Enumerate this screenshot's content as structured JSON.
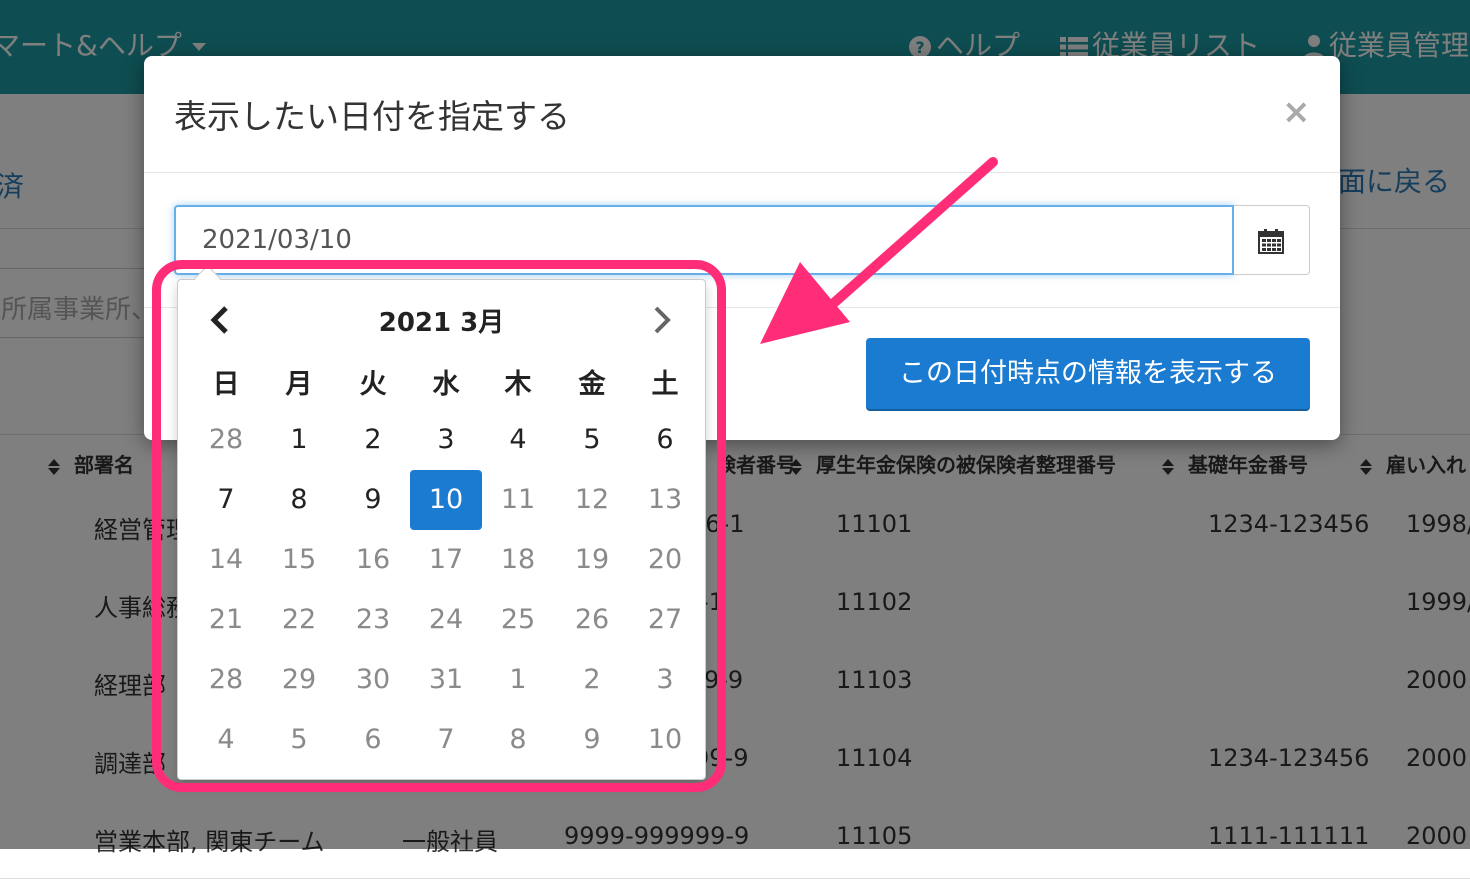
{
  "navbar": {
    "left_label": "マート&ヘルプ",
    "help_label": "ヘルプ",
    "list_label": "従業員リスト",
    "manage_label": "従業員管理"
  },
  "background": {
    "left_link": "済",
    "right_link": "面に戻る",
    "search_placeholder": "所属事業所、",
    "table": {
      "headers": [
        "部署名",
        "険者番号",
        "厚生年金保険の被保険者整理番号",
        "基礎年金番号",
        "雇い入れ"
      ],
      "rows": [
        [
          "経営管理",
          "",
          "56-1",
          "11101",
          "1234-123456",
          "1998/"
        ],
        [
          "人事総務",
          "",
          "-1",
          "11102",
          "",
          "1999/"
        ],
        [
          "経理部",
          "",
          "9-9",
          "11103",
          "",
          "2000"
        ],
        [
          "調達部",
          "",
          "99-9",
          "11104",
          "1234-123456",
          "2000"
        ],
        [
          "営業本部, 関東チーム",
          "一般社員",
          "9999-999999-9",
          "11105",
          "1111-111111",
          "2000"
        ]
      ]
    }
  },
  "modal": {
    "title": "表示したい日付を指定する",
    "close": "×",
    "date_value": "2021/03/10",
    "calendar_icon": "calendar-icon",
    "submit_label": "この日付時点の情報を表示する"
  },
  "datepicker": {
    "month_label": "2021 3月",
    "prev_icon": "chevron-left-icon",
    "next_icon": "chevron-right-icon",
    "weekdays": [
      "日",
      "月",
      "火",
      "水",
      "木",
      "金",
      "土"
    ],
    "selected": "10",
    "weeks": [
      [
        [
          "28",
          "muted"
        ],
        [
          "1",
          "in"
        ],
        [
          "2",
          "in"
        ],
        [
          "3",
          "in"
        ],
        [
          "4",
          "in"
        ],
        [
          "5",
          "in"
        ],
        [
          "6",
          "in"
        ]
      ],
      [
        [
          "7",
          "in"
        ],
        [
          "8",
          "in"
        ],
        [
          "9",
          "in"
        ],
        [
          "10",
          "active"
        ],
        [
          "11",
          "muted"
        ],
        [
          "12",
          "muted"
        ],
        [
          "13",
          "muted"
        ]
      ],
      [
        [
          "14",
          "muted"
        ],
        [
          "15",
          "muted"
        ],
        [
          "16",
          "muted"
        ],
        [
          "17",
          "muted"
        ],
        [
          "18",
          "muted"
        ],
        [
          "19",
          "muted"
        ],
        [
          "20",
          "muted"
        ]
      ],
      [
        [
          "21",
          "muted"
        ],
        [
          "22",
          "muted"
        ],
        [
          "23",
          "muted"
        ],
        [
          "24",
          "muted"
        ],
        [
          "25",
          "muted"
        ],
        [
          "26",
          "muted"
        ],
        [
          "27",
          "muted"
        ]
      ],
      [
        [
          "28",
          "muted"
        ],
        [
          "29",
          "muted"
        ],
        [
          "30",
          "muted"
        ],
        [
          "31",
          "muted"
        ],
        [
          "1",
          "muted"
        ],
        [
          "2",
          "muted"
        ],
        [
          "3",
          "muted"
        ]
      ],
      [
        [
          "4",
          "muted"
        ],
        [
          "5",
          "muted"
        ],
        [
          "6",
          "muted"
        ],
        [
          "7",
          "muted"
        ],
        [
          "8",
          "muted"
        ],
        [
          "9",
          "muted"
        ],
        [
          "10",
          "muted"
        ]
      ]
    ]
  },
  "annotation": {
    "highlight_color": "#ff2d78"
  }
}
